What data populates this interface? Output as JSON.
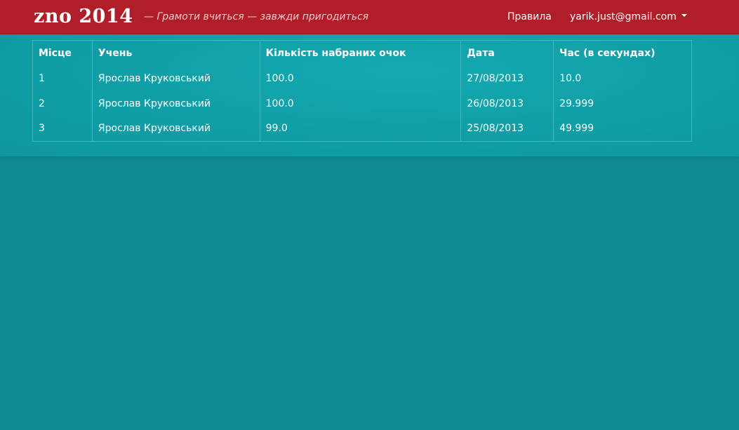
{
  "header": {
    "brand": "zno 2014",
    "tagline": "— Грамоти вчиться — завжди пригодиться",
    "nav_rules": "Правила",
    "user_email": "yarik.just@gmail.com",
    "user_menu_icon": "caret-down-icon"
  },
  "table": {
    "columns": [
      "Місце",
      "Учень",
      "Кількість набраних очок",
      "Дата",
      "Час (в секундах)"
    ],
    "rows": [
      [
        "1",
        "Ярослав Круковський",
        "100.0",
        "27/08/2013",
        "10.0"
      ],
      [
        "2",
        "Ярослав Круковський",
        "100.0",
        "26/08/2013",
        "29.999"
      ],
      [
        "3",
        "Ярослав Круковський",
        "99.0",
        "25/08/2013",
        "49.999"
      ]
    ]
  },
  "colors": {
    "navbar": "#b01f29",
    "content_band": "#11a0a8",
    "page_background": "#108a91",
    "table_border": "#3cb8be",
    "text": "#ffffff"
  }
}
